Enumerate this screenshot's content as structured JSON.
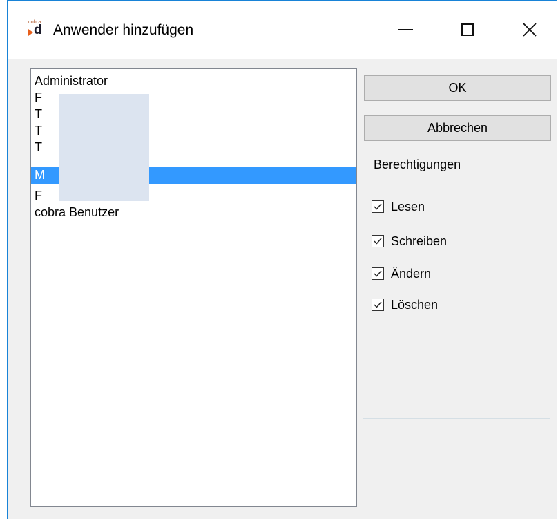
{
  "window": {
    "title": "Anwender hinzufügen",
    "icon_brand_text": "cobra",
    "icon_letter": "d"
  },
  "users": {
    "items": [
      {
        "label": "Administrator",
        "selected": false
      },
      {
        "label": "F",
        "selected": false
      },
      {
        "label": "T",
        "selected": false
      },
      {
        "label": "T",
        "selected": false
      },
      {
        "label": "T",
        "selected": false
      },
      {
        "label": "M",
        "selected": true
      },
      {
        "label": "F",
        "selected": false
      },
      {
        "label": "cobra Benutzer",
        "selected": false
      }
    ],
    "selection_color": "#3399ff"
  },
  "buttons": {
    "ok_label": "OK",
    "cancel_label": "Abbrechen"
  },
  "permissions": {
    "group_label": "Berechtigungen",
    "items": [
      {
        "label": "Lesen",
        "checked": true
      },
      {
        "label": "Schreiben",
        "checked": true
      },
      {
        "label": "Ändern",
        "checked": true
      },
      {
        "label": "Löschen",
        "checked": true
      }
    ]
  },
  "icons": [
    "cobra-app-icon",
    "minimize-icon",
    "maximize-icon",
    "close-icon",
    "checkmark-icon"
  ]
}
